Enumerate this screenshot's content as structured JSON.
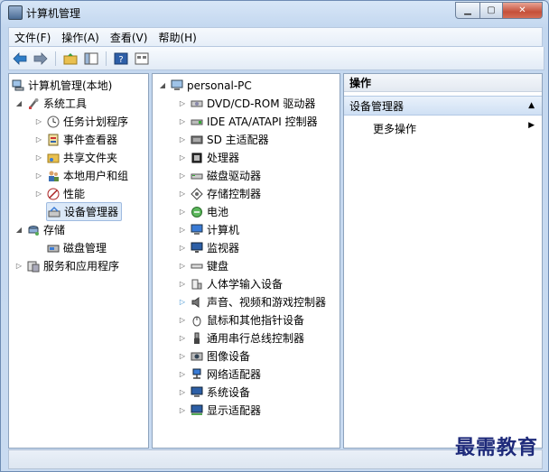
{
  "window": {
    "title": "计算机管理"
  },
  "menu": [
    "文件(F)",
    "操作(A)",
    "查看(V)",
    "帮助(H)"
  ],
  "toolbar": {
    "back_icon": "arrow-left-icon",
    "forward_icon": "arrow-right-icon",
    "up_icon": "folder-up-icon",
    "show_hide_tree_icon": "console-tree-icon",
    "help_icon": "help-icon",
    "properties_icon": "properties-icon"
  },
  "left_tree": {
    "root": "计算机管理(本地)",
    "system_tools": "系统工具",
    "task_scheduler": "任务计划程序",
    "event_viewer": "事件查看器",
    "shared_folders": "共享文件夹",
    "local_users": "本地用户和组",
    "performance": "性能",
    "device_manager": "设备管理器",
    "storage": "存储",
    "disk_management": "磁盘管理",
    "services_apps": "服务和应用程序"
  },
  "device_tree": {
    "root": "personal-PC",
    "items": [
      "DVD/CD-ROM 驱动器",
      "IDE ATA/ATAPI 控制器",
      "SD 主适配器",
      "处理器",
      "磁盘驱动器",
      "存储控制器",
      "电池",
      "计算机",
      "监视器",
      "键盘",
      "人体学输入设备",
      "声音、视频和游戏控制器",
      "鼠标和其他指针设备",
      "通用串行总线控制器",
      "图像设备",
      "网络适配器",
      "系统设备",
      "显示适配器"
    ]
  },
  "actions": {
    "header": "操作",
    "section": "设备管理器",
    "more": "更多操作"
  },
  "watermark": "最需教育"
}
